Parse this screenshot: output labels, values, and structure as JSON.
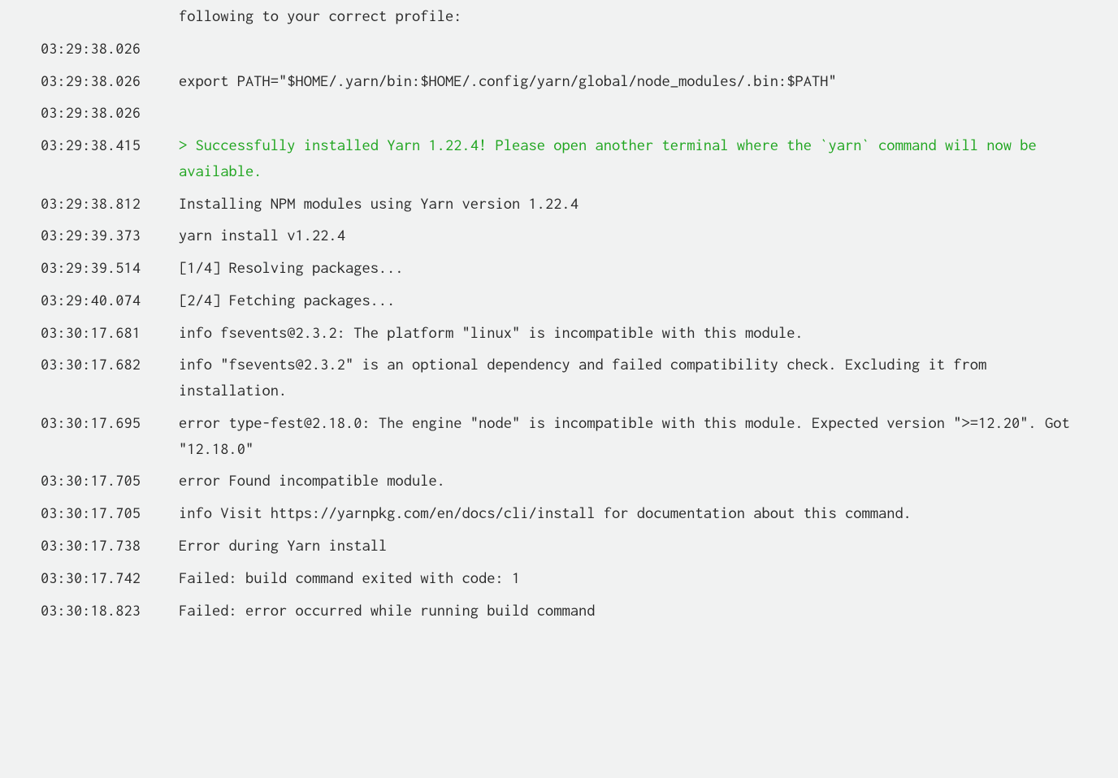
{
  "colors": {
    "bg": "#f1f2f2",
    "text": "#2a2a2a",
    "success": "#1fa51f"
  },
  "log": [
    {
      "ts": "",
      "msg": "following to your correct profile:",
      "cls": ""
    },
    {
      "ts": "03:29:38.026",
      "msg": "",
      "cls": "empty"
    },
    {
      "ts": "03:29:38.026",
      "msg": "export PATH=\"$HOME/.yarn/bin:$HOME/.config/yarn/global/node_modules/.bin:$PATH\"",
      "cls": ""
    },
    {
      "ts": "03:29:38.026",
      "msg": "",
      "cls": "empty"
    },
    {
      "ts": "03:29:38.415",
      "msg": "> Successfully installed Yarn 1.22.4! Please open another terminal where the `yarn` command will now be available.",
      "cls": "success"
    },
    {
      "ts": "03:29:38.812",
      "msg": "Installing NPM modules using Yarn version 1.22.4",
      "cls": ""
    },
    {
      "ts": "03:29:39.373",
      "msg": "yarn install v1.22.4",
      "cls": ""
    },
    {
      "ts": "03:29:39.514",
      "msg": "[1/4] Resolving packages...",
      "cls": ""
    },
    {
      "ts": "03:29:40.074",
      "msg": "[2/4] Fetching packages...",
      "cls": ""
    },
    {
      "ts": "03:30:17.681",
      "msg": "info fsevents@2.3.2: The platform \"linux\" is incompatible with this module.",
      "cls": ""
    },
    {
      "ts": "03:30:17.682",
      "msg": "info \"fsevents@2.3.2\" is an optional dependency and failed compatibility check. Excluding it from installation.",
      "cls": ""
    },
    {
      "ts": "03:30:17.695",
      "msg": "error type-fest@2.18.0: The engine \"node\" is incompatible with this module. Expected version \">=12.20\". Got \"12.18.0\"",
      "cls": ""
    },
    {
      "ts": "03:30:17.705",
      "msg": "error Found incompatible module.",
      "cls": ""
    },
    {
      "ts": "03:30:17.705",
      "msg": "info Visit https://yarnpkg.com/en/docs/cli/install for documentation about this command.",
      "cls": ""
    },
    {
      "ts": "03:30:17.738",
      "msg": "Error during Yarn install",
      "cls": ""
    },
    {
      "ts": "03:30:17.742",
      "msg": "Failed: build command exited with code: 1",
      "cls": ""
    },
    {
      "ts": "03:30:18.823",
      "msg": "Failed: error occurred while running build command",
      "cls": ""
    }
  ]
}
